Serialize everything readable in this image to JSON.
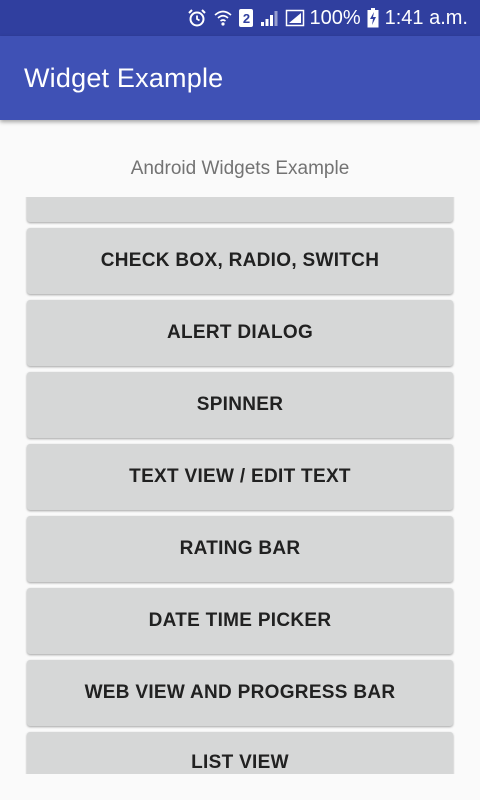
{
  "status_bar": {
    "battery_percent": "100%",
    "time": "1:41 a.m.",
    "sim_label": "2"
  },
  "app_bar": {
    "title": "Widget Example"
  },
  "main": {
    "subtitle": "Android Widgets Example",
    "buttons": [
      {
        "label": ""
      },
      {
        "label": "CHECK BOX, RADIO, SWITCH"
      },
      {
        "label": "ALERT DIALOG"
      },
      {
        "label": "SPINNER"
      },
      {
        "label": "TEXT VIEW / EDIT TEXT"
      },
      {
        "label": "RATING BAR"
      },
      {
        "label": "DATE TIME PICKER"
      },
      {
        "label": "WEB VIEW AND PROGRESS BAR"
      },
      {
        "label": "LIST VIEW"
      }
    ]
  },
  "colors": {
    "status_bar": "#303f9f",
    "app_bar": "#3f51b5",
    "button_bg": "#d6d7d7",
    "button_text": "#212121",
    "subtitle_text": "#737373"
  },
  "icons": [
    "alarm-icon",
    "wifi-icon",
    "sim-icon",
    "signal-icon",
    "signal-icon",
    "battery-charging-icon"
  ]
}
